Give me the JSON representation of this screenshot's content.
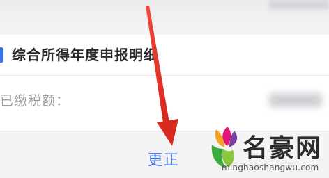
{
  "section": {
    "title": "综合所得年度申报明细"
  },
  "field": {
    "label": "已缴税额："
  },
  "actions": {
    "correct_label": "更正"
  },
  "watermark": {
    "name": "名豪网",
    "url": "minghaoshangwu.com"
  },
  "colors": {
    "accent": "#3d74e8",
    "link": "#3d6fd9",
    "arrow": "#e8342b",
    "background": "#f3f3f5"
  },
  "icons": {
    "annotation": "red-arrow-icon",
    "logo": "leaf-face-logo-icon"
  }
}
